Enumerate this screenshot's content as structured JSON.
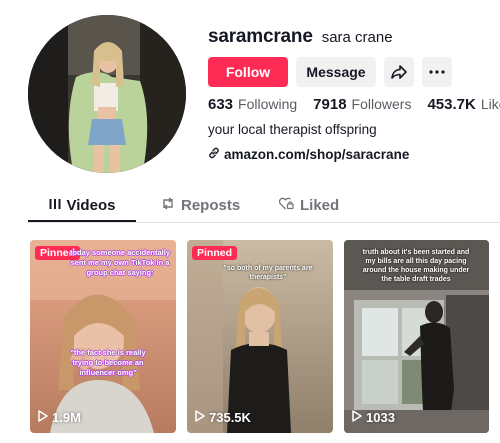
{
  "profile": {
    "username": "saramcrane",
    "nickname": "sara crane",
    "bio": "your local therapist offspring",
    "link": "amazon.com/shop/saracrane",
    "stats": {
      "following_count": "633",
      "following_label": "Following",
      "followers_count": "7918",
      "followers_label": "Followers",
      "likes_count": "453.7K",
      "likes_label": "Likes"
    }
  },
  "actions": {
    "follow_label": "Follow",
    "message_label": "Message",
    "share_icon": "share-icon",
    "more_icon": "more-icon"
  },
  "tabs": [
    {
      "label": "Videos",
      "icon": "grid-icon",
      "active": true
    },
    {
      "label": "Reposts",
      "icon": "repost-icon",
      "active": false
    },
    {
      "label": "Liked",
      "icon": "heart-lock-icon",
      "active": false
    }
  ],
  "videos": [
    {
      "pinned_label": "Pinned",
      "views": "1.9M",
      "caption_top": "today someone accidentally sent me my own TikTok in a group chat saying:",
      "caption_bottom": "\"the fact she is really trying to become an influencer omg\""
    },
    {
      "pinned_label": "Pinned",
      "views": "735.5K",
      "caption_top": "\"so both of my parents are therapists\""
    },
    {
      "views": "1033",
      "caption_top": "truth about it's been started and my bills are all this day pacing around the house making under the table draft trades"
    }
  ],
  "colors": {
    "accent": "#fe2c55",
    "text": "#161823",
    "muted": "#73737a"
  }
}
